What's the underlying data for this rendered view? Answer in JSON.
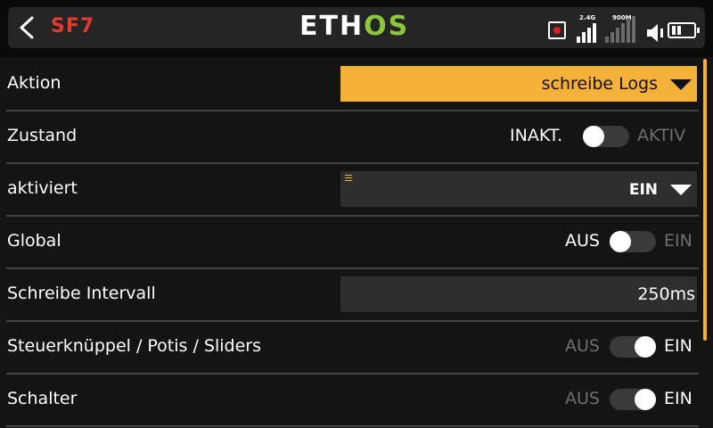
{
  "header": {
    "page_id": "SF7",
    "brand_part1": "ETH",
    "brand_part2": "OS",
    "signal1_label": "2.4G",
    "signal2_label": "900M"
  },
  "rows": [
    {
      "label": "Aktion",
      "type": "dropdown",
      "value": "schreibe Logs",
      "highlighted": true
    },
    {
      "label": "Zustand",
      "type": "toggle",
      "off_label": "INAKT.",
      "on_label": "AKTIV",
      "state": "off"
    },
    {
      "label": "aktiviert",
      "type": "dropdown",
      "value": "EIN",
      "highlighted": false
    },
    {
      "label": "Global",
      "type": "toggle",
      "off_label": "AUS",
      "on_label": "EIN",
      "state": "off"
    },
    {
      "label": "Schreibe Intervall",
      "type": "value",
      "value": "250ms"
    },
    {
      "label": "Steuerknüppel / Potis / Sliders",
      "type": "toggle",
      "off_label": "AUS",
      "on_label": "EIN",
      "state": "on"
    },
    {
      "label": "Schalter",
      "type": "toggle",
      "off_label": "AUS",
      "on_label": "EIN",
      "state": "on"
    }
  ],
  "colors": {
    "accent": "#f5b137",
    "brand_green": "#8cc63f",
    "page_id_red": "#e23b2e",
    "background": "#141414"
  },
  "icons": {
    "back": "chevron-left-icon",
    "record": "record-icon",
    "signal": "signal-bars-icon",
    "speaker": "speaker-icon",
    "battery": "battery-icon",
    "menu": "menu-lines-icon"
  }
}
